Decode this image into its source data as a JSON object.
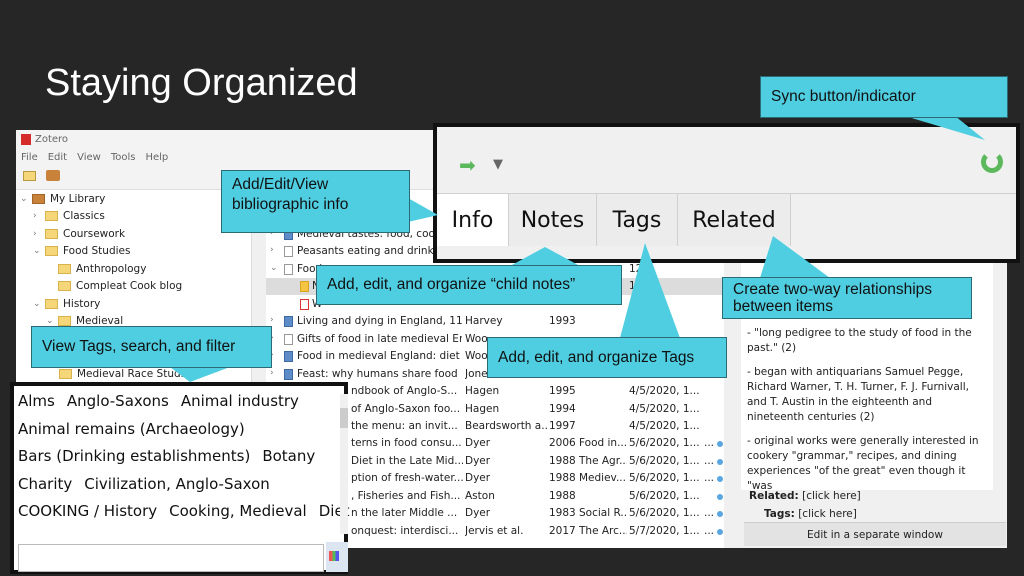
{
  "slide": {
    "title": "Staying Organized"
  },
  "zotero": {
    "app_title": "Zotero",
    "menu": [
      "File",
      "Edit",
      "View",
      "Tools",
      "Help"
    ],
    "collections": [
      {
        "label": "My Library",
        "level": 0,
        "chevron": "v",
        "icon": "library-icon"
      },
      {
        "label": "Classics",
        "level": 1,
        "chevron": ">",
        "icon": "folder-icon"
      },
      {
        "label": "Coursework",
        "level": 1,
        "chevron": ">",
        "icon": "folder-icon"
      },
      {
        "label": "Food Studies",
        "level": 1,
        "chevron": "v",
        "icon": "folder-icon"
      },
      {
        "label": "Anthropology",
        "level": 2,
        "chevron": "",
        "icon": "folder-icon"
      },
      {
        "label": "Compleat Cook blog",
        "level": 2,
        "chevron": "",
        "icon": "folder-icon"
      },
      {
        "label": "History",
        "level": 1,
        "chevron": "v",
        "icon": "folder-icon"
      },
      {
        "label": "Medieval",
        "level": 2,
        "chevron": "v",
        "icon": "folder-icon"
      }
    ],
    "collection_bottom": "Medieval Race Studies",
    "items": [
      {
        "title": "Medieval tastes: food, cooking",
        "creator": "",
        "year": "",
        "pub": "",
        "date": "",
        "icon": "book"
      },
      {
        "title": "Peasants eating and drinking",
        "creator": "",
        "year": "",
        "pub": "",
        "date": "",
        "icon": "doc"
      },
      {
        "title": "Food",
        "creator": "",
        "year": "",
        "pub": "",
        "date": "12/",
        "icon": "doc"
      },
      {
        "title": "N",
        "creator": "",
        "year": "",
        "pub": "",
        "date": "12/",
        "icon": "note"
      },
      {
        "title": "W",
        "creator": "",
        "year": "",
        "pub": "",
        "date": "",
        "icon": "pdf"
      },
      {
        "title": "Living and dying in England, 11...",
        "creator": "Harvey",
        "year": "1993",
        "pub": "",
        "date": "",
        "icon": "book"
      },
      {
        "title": "Gifts of food in late medieval En...",
        "creator": "Woo",
        "year": "",
        "pub": "",
        "date": "",
        "icon": "doc"
      },
      {
        "title": "Food in medieval England: diet ...",
        "creator": "Woo",
        "year": "",
        "pub": "",
        "date": "",
        "icon": "book"
      },
      {
        "title": "Feast: why humans share food",
        "creator": "Jone",
        "year": "",
        "pub": "",
        "date": "",
        "icon": "book"
      },
      {
        "title": "ndbook of Anglo-S...",
        "creator": "Hagen",
        "year": "1995",
        "pub": "",
        "date": "4/5/2020, 1...",
        "icon": ""
      },
      {
        "title": "of Anglo-Saxon foo...",
        "creator": "Hagen",
        "year": "1994",
        "pub": "",
        "date": "4/5/2020, 1...",
        "icon": ""
      },
      {
        "title": "the menu: an invit...",
        "creator": "Beardsworth a...",
        "year": "1997",
        "pub": "",
        "date": "4/5/2020, 1...",
        "icon": ""
      },
      {
        "title": "terns in food consu...",
        "creator": "Dyer",
        "year": "2006",
        "pub": "Food in...",
        "date": "5/6/2020, 1...",
        "icon": ""
      },
      {
        "title": "Diet in the Late Mid...",
        "creator": "Dyer",
        "year": "1988",
        "pub": "The Agr...",
        "date": "5/6/2020, 1...",
        "icon": ""
      },
      {
        "title": "ption of fresh-water...",
        "creator": "Dyer",
        "year": "1988",
        "pub": "Mediev...",
        "date": "5/6/2020, 1...",
        "icon": ""
      },
      {
        "title": ", Fisheries and Fish...",
        "creator": "Aston",
        "year": "1988",
        "pub": "",
        "date": "5/6/2020, 1...",
        "icon": ""
      },
      {
        "title": "n the later Middle ...",
        "creator": "Dyer",
        "year": "1983",
        "pub": "Social R...",
        "date": "5/6/2020, 1...",
        "icon": ""
      },
      {
        "title": "onquest: interdisci...",
        "creator": "Jervis et al.",
        "year": "2017",
        "pub": "The Arc...",
        "date": "5/7/2020, 1...",
        "icon": ""
      }
    ],
    "note": {
      "paragraphs": [
        "- \"long pedigree to the study of food in the past.\" (2)",
        "- began with antiquarians Samuel Pegge, Richard Warner, T. H. Turner, F. J. Furnivall, and T. Austin in the eighteenth and nineteenth centuries (2)",
        "- original works were generally interested in cookery \"grammar,\" recipes, and dining experiences \"of the great\" even though it \"was"
      ],
      "related_label": "Related:",
      "related_value": "[click here]",
      "tags_label": "Tags:",
      "tags_value": "[click here]",
      "edit_button": "Edit in a separate window"
    }
  },
  "item_pane": {
    "tabs": [
      "Info",
      "Notes",
      "Tags",
      "Related"
    ],
    "active_tab": "Info"
  },
  "tag_selector": {
    "lines": [
      [
        "Alms",
        "Anglo-Saxons",
        "Animal industry"
      ],
      [
        "Animal remains (Archaeology)"
      ],
      [
        "Bars (Drinking establishments)",
        "Botany"
      ],
      [
        "Charity",
        "Civilization, Anglo-Saxon"
      ],
      [
        "COOKING / History",
        "Cooking, Medieval",
        "Diet"
      ]
    ],
    "search_value": ""
  },
  "callouts": {
    "sync": "Sync button/indicator",
    "info": "Add/Edit/View bibliographic info",
    "notes": "Add, edit, and organize “child notes”",
    "tags": "Add, edit, and organize Tags",
    "related": "Create two-way relationships between items",
    "tagsel": "View Tags, search, and filter"
  },
  "colors": {
    "callout": "#4fcee1",
    "background": "#262626",
    "sync_green": "#5cb85c"
  }
}
